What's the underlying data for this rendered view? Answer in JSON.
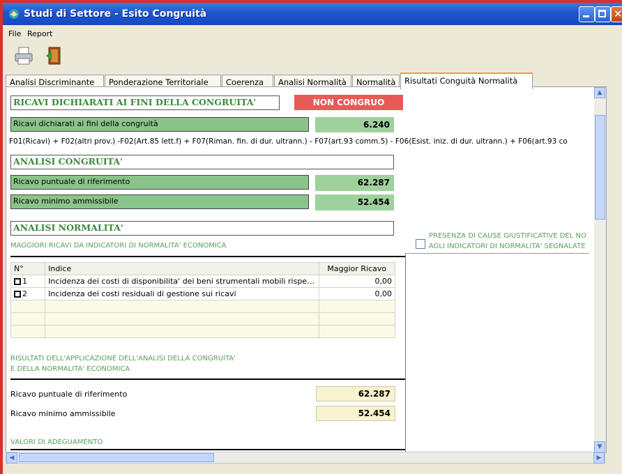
{
  "window": {
    "title": "Studi di Settore - Esito Congruità"
  },
  "menu": [
    "File",
    "Report"
  ],
  "toolbar": {
    "icons": [
      "printer-icon",
      "exit-icon"
    ]
  },
  "tabs": [
    "Analisi Discriminante",
    "Ponderazione Territoriale",
    "Coerenza",
    "Analisi Normalità",
    "Normalità",
    "Risultati Conguità Normalità"
  ],
  "active_tab": 5,
  "content": {
    "ricavi_header": "RICAVI DICHIARATI AI FINI DELLA CONGRUITA'",
    "status_badge": "NON CONGRUO",
    "ricavi_dichiarati": {
      "label": "Ricavi dichiarati ai fini della congruità",
      "value": "6.240"
    },
    "formula": "F01(Ricavi) + F02(altri prov.) -F02(Art.85 lett.f) + F07(Riman. fin. di dur. ultrann.) - F07(art.93 comm.5) - F06(Esist. iniz. di dur. ultrann.) + F06(art.93 co",
    "analisi_congruita_header": "ANALISI CONGRUITA'",
    "ricavo_puntuale": {
      "label": "Ricavo puntuale di riferimento",
      "value": "62.287"
    },
    "ricavo_minimo": {
      "label": "Ricavo minimo ammissibile",
      "value": "52.454"
    },
    "analisi_normalita_header": "ANALISI NORMALITA'",
    "maggiori_ricavi_label": "MAGGIORI RICAVI DA INDICATORI DI NORMALITA' ECONOMICA",
    "presenza_cause_line1": "PRESENZA DI CAUSE GIUSTIFICATIVE DEL NO",
    "presenza_cause_line2": "AGLI INDICATORI DI NORMALITA' SEGNALATE",
    "table": {
      "headers": [
        "N°",
        "Indice",
        "Maggior Ricavo"
      ],
      "rows": [
        {
          "n": "1",
          "indice": "Incidenza dei costi di disponibilita' dei beni strumentali mobili rispe…",
          "valore": "0,00"
        },
        {
          "n": "2",
          "indice": "Incidenza dei costi residuali di gestione sui ricavi",
          "valore": "0,00"
        }
      ]
    },
    "risultati_label_line1": "RISULTATI DELL'APPLICAZIONE DELL'ANALISI DELLA CONGRUITA'",
    "risultati_label_line2": "E DELLA NORMALITA' ECONOMICA",
    "ricavo_puntuale_finale": {
      "label": "Ricavo puntuale di riferimento",
      "value": "62.287"
    },
    "ricavo_minimo_finale": {
      "label": "Ricavo minimo ammissibile",
      "value": "52.454"
    },
    "valori_adeguamento_label": "VALORI DI ADEGUAMENTO"
  },
  "colors": {
    "header_text": "#3a8a3a",
    "green_fill": "#8ac48a",
    "badge": "#e85a58",
    "yellow_fill": "#f7f2cf",
    "tab_accent": "#f0a02a"
  }
}
